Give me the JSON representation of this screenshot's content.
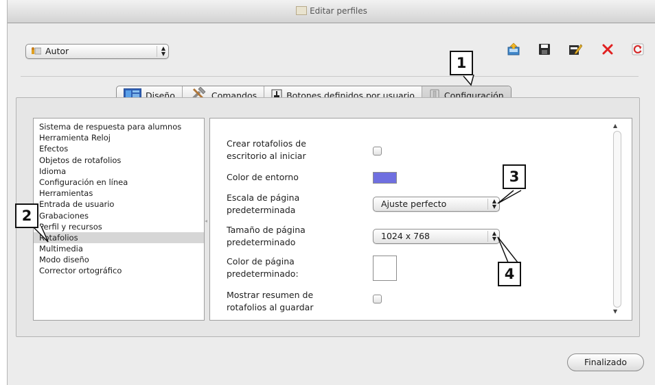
{
  "window": {
    "title": "Editar perfiles"
  },
  "profile_select": {
    "value": "Autor"
  },
  "toolbar": {
    "icons": [
      "upload-profile-icon",
      "save-icon",
      "edit-icon",
      "delete-icon",
      "refresh-icon"
    ],
    "delete_color": "#e02020",
    "refresh_color": "#d42a2a"
  },
  "tabs": [
    {
      "label": "Diseño",
      "icon": "design-icon"
    },
    {
      "label": "Comandos",
      "icon": "tools-icon"
    },
    {
      "label": "Botones definidos por usuario",
      "icon": "user-button-icon"
    },
    {
      "label": "Configuración",
      "icon": "settings-icon"
    }
  ],
  "categories": {
    "items": [
      "Sistema de respuesta para alumnos",
      "Herramienta Reloj",
      "Efectos",
      "Objetos de rotafolios",
      "Idioma",
      "Configuración en línea",
      "Herramientas",
      "Entrada de usuario",
      "Grabaciones",
      "Perfil y recursos",
      "Rotafolios",
      "Multimedia",
      "Modo diseño",
      "Corrector ortográfico"
    ],
    "selected": "Rotafolios"
  },
  "settings": {
    "crear_rotafolios": {
      "label": "Crear rotafolios de escritorio al iniciar",
      "checked": false
    },
    "color_entorno": {
      "label": "Color de entorno",
      "color": "#6f6fe0"
    },
    "escala": {
      "label": "Escala de página predeterminada",
      "value": "Ajuste perfecto"
    },
    "tamano": {
      "label": "Tamaño de página predeterminado",
      "value": "1024 x 768"
    },
    "color_pagina": {
      "label": "Color de página predeterminado:",
      "color": "#ffffff"
    },
    "mostrar_resumen": {
      "label": "Mostrar resumen de rotafolios al guardar",
      "checked": false
    }
  },
  "callouts": [
    "1",
    "2",
    "3",
    "4"
  ],
  "footer": {
    "done_label": "Finalizado"
  }
}
